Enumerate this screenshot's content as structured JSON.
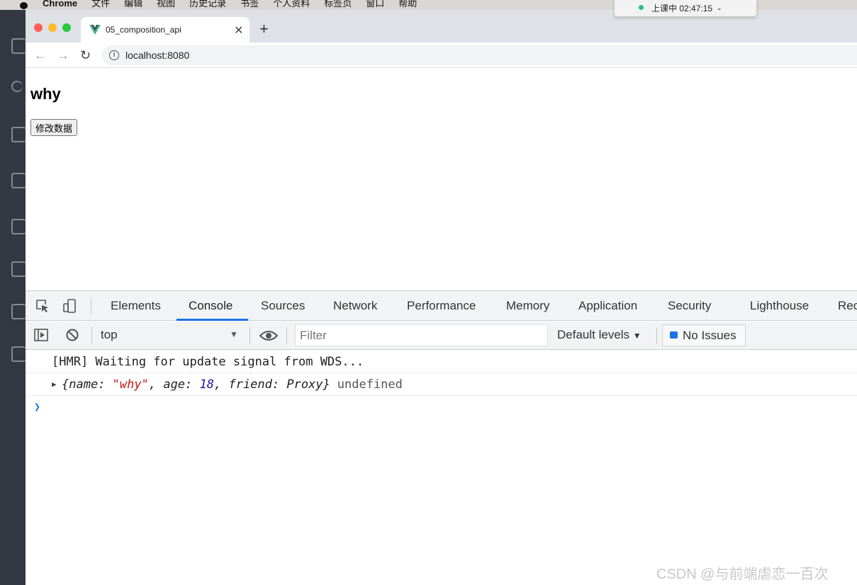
{
  "menubar": {
    "app": "Chrome",
    "items": [
      "文件",
      "编辑",
      "视图",
      "历史记录",
      "书签",
      "个人资料",
      "标签页",
      "窗口",
      "帮助"
    ]
  },
  "status_popup": {
    "text": "上课中 02:47:15"
  },
  "browser": {
    "tab_title": "05_composition_api",
    "url": "localhost:8080",
    "favicon": "vue-icon"
  },
  "page": {
    "heading": "why",
    "button_label": "修改数据"
  },
  "devtools": {
    "tabs": [
      "Elements",
      "Console",
      "Sources",
      "Network",
      "Performance",
      "Memory",
      "Application",
      "Security",
      "Lighthouse",
      "Rec"
    ],
    "active_tab": "Console",
    "context": "top",
    "filter_placeholder": "Filter",
    "levels": "Default levels",
    "issues": "No Issues"
  },
  "console": {
    "line1": "[HMR] Waiting for update signal from WDS...",
    "obj": {
      "open": "{",
      "k1": "name: ",
      "v1": "\"why\"",
      "k2": ", age: ",
      "v2": "18",
      "k3": ", friend: Proxy}",
      "tail": "undefined"
    }
  },
  "watermark": "CSDN @与前端虐恋一百次",
  "colors": {
    "accent": "#1a73e8",
    "string": "#c41a16",
    "number": "#1a1aa6"
  }
}
